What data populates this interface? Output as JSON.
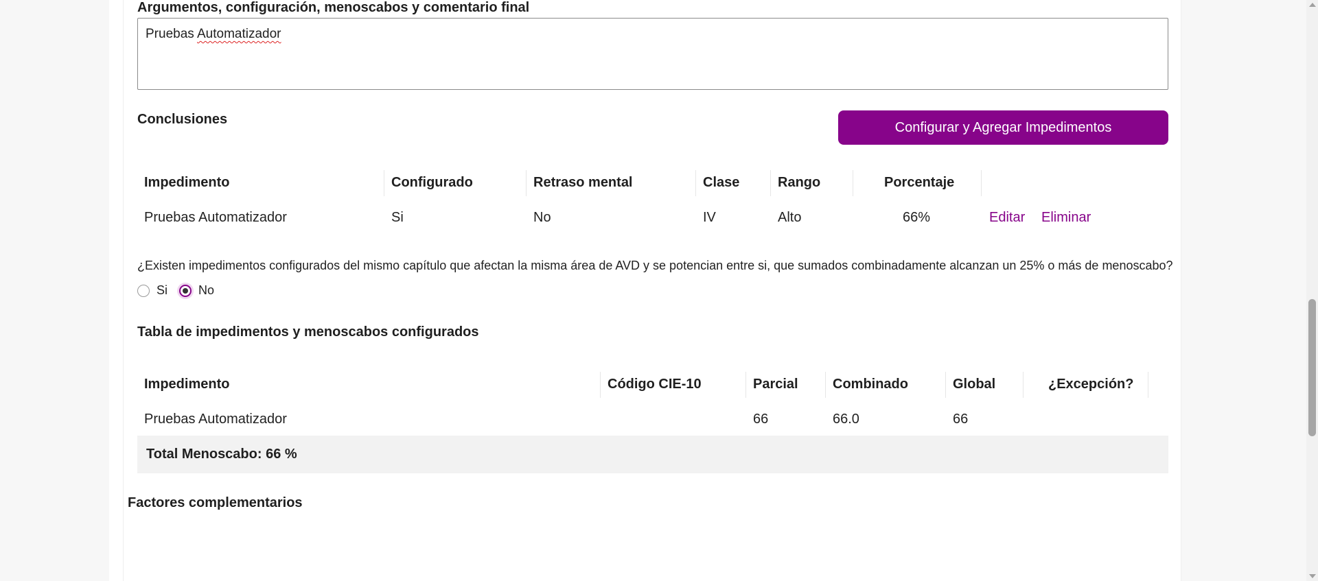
{
  "final_comment": {
    "label": "Argumentos, configuración, menoscabos y comentario final",
    "value_plain": "Pruebas ",
    "value_misspelled": "Automatizador"
  },
  "conclusions": {
    "title": "Conclusiones",
    "add_button_label": "Configurar y Agregar Impedimentos",
    "headers": {
      "impedimento": "Impedimento",
      "configurado": "Configurado",
      "retraso": "Retraso mental",
      "clase": "Clase",
      "rango": "Rango",
      "porcentaje": "Porcentaje"
    },
    "rows": [
      {
        "impedimento": "Pruebas Automatizador",
        "configurado": "Si",
        "retraso": "No",
        "clase": "IV",
        "rango": "Alto",
        "porcentaje": "66%",
        "edit_label": "Editar",
        "delete_label": "Eliminar"
      }
    ]
  },
  "question": {
    "text": "¿Existen impedimentos configurados del mismo capítulo que afectan la misma área de AVD y se potencian entre si, que sumados combinadamente alcanzan un 25% o más de menoscabo?",
    "options": [
      {
        "label": "Si",
        "checked": false
      },
      {
        "label": "No",
        "checked": true
      }
    ]
  },
  "impairments_table": {
    "title": "Tabla de impedimentos y menoscabos configurados",
    "headers": {
      "impedimento": "Impedimento",
      "cie10": "Código CIE-10",
      "parcial": "Parcial",
      "combinado": "Combinado",
      "global": "Global",
      "excepcion": "¿Excepción?"
    },
    "rows": [
      {
        "impedimento": "Pruebas Automatizador",
        "cie10": "",
        "parcial": "66",
        "combinado": "66.0",
        "global": "66",
        "excepcion": ""
      }
    ],
    "total_label": "Total Menoscabo: 66 %"
  },
  "complementary": {
    "title": "Factores complementarios"
  },
  "colors": {
    "accent": "#87048a"
  }
}
